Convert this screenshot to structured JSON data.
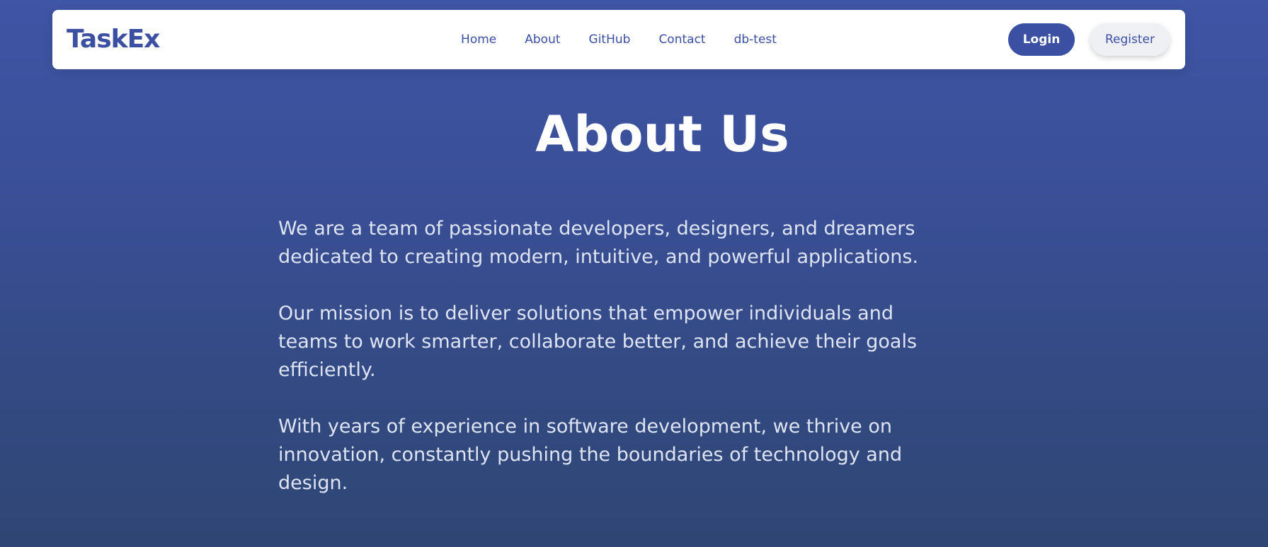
{
  "navbar": {
    "brand": "TaskEx",
    "links": [
      "Home",
      "About",
      "GitHub",
      "Contact",
      "db-test"
    ],
    "login_label": "Login",
    "register_label": "Register"
  },
  "main": {
    "title": "About Us",
    "paragraphs": [
      "We are a team of passionate developers, designers, and dreamers dedicated to creating modern, intuitive, and powerful applications.",
      "Our mission is to deliver solutions that empower individuals and teams to work smarter, collaborate better, and achieve their goals efficiently.",
      "With years of experience in software development, we thrive on innovation, constantly pushing the boundaries of technology and design."
    ]
  },
  "colors": {
    "primary": "#3b4fa3",
    "background_top": "#3f55a5",
    "background_bottom": "#2f4674",
    "text_light": "#dfe4f2"
  }
}
